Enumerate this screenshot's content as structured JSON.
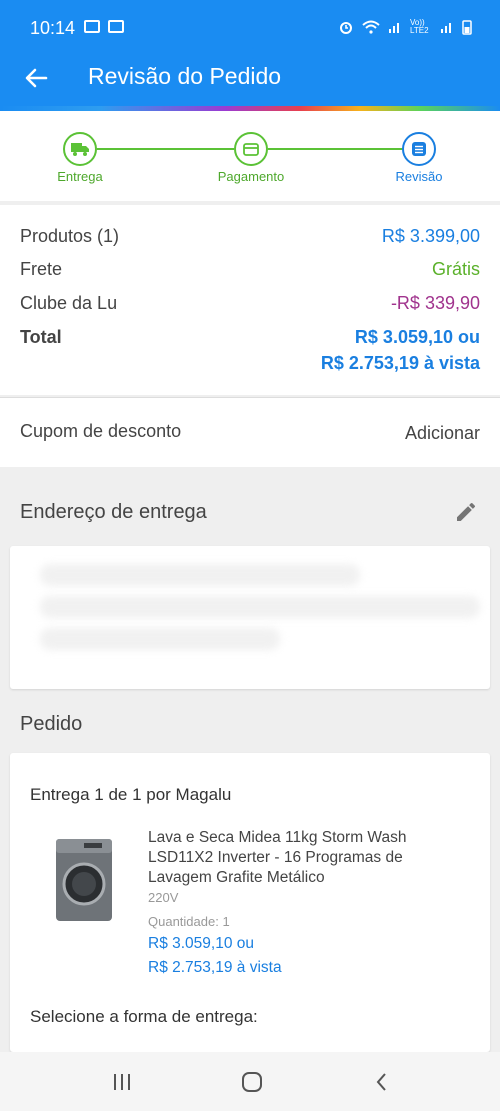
{
  "status_bar": {
    "time": "10:14",
    "network": "Vo)) LTE2"
  },
  "app_bar": {
    "title": "Revisão do Pedido"
  },
  "stepper": {
    "steps": [
      {
        "label": "Entrega",
        "icon": "truck-icon",
        "state": "done"
      },
      {
        "label": "Pagamento",
        "icon": "card-icon",
        "state": "done"
      },
      {
        "label": "Revisão",
        "icon": "list-icon",
        "state": "active"
      }
    ]
  },
  "summary": {
    "products_label": "Produtos (1)",
    "products_value": "R$ 3.399,00",
    "shipping_label": "Frete",
    "shipping_value": "Grátis",
    "club_label": "Clube da Lu",
    "club_value": "-R$ 339,90",
    "total_label": "Total",
    "total_value": "R$ 3.059,10 ou",
    "total_cash": "R$ 2.753,19 à vista"
  },
  "coupon": {
    "label": "Cupom de desconto",
    "action": "Adicionar"
  },
  "address": {
    "title": "Endereço de entrega"
  },
  "order": {
    "title": "Pedido",
    "delivery": "Entrega 1 de 1 por Magalu",
    "product_name": "Lava e Seca Midea 11kg Storm Wash LSD11X2 Inverter - 16 Programas de Lavagem Grafite Metálico",
    "voltage": "220V",
    "quantity": "Quantidade:  1",
    "price": "R$ 3.059,10 ou",
    "price_cash": "R$ 2.753,19 à vista",
    "shipping_select": "Selecione a forma de entrega:"
  },
  "colors": {
    "primary": "#1a8cf2",
    "accent_blue": "#1a7fe0",
    "green": "#5bb12b",
    "purple": "#a0338d"
  }
}
